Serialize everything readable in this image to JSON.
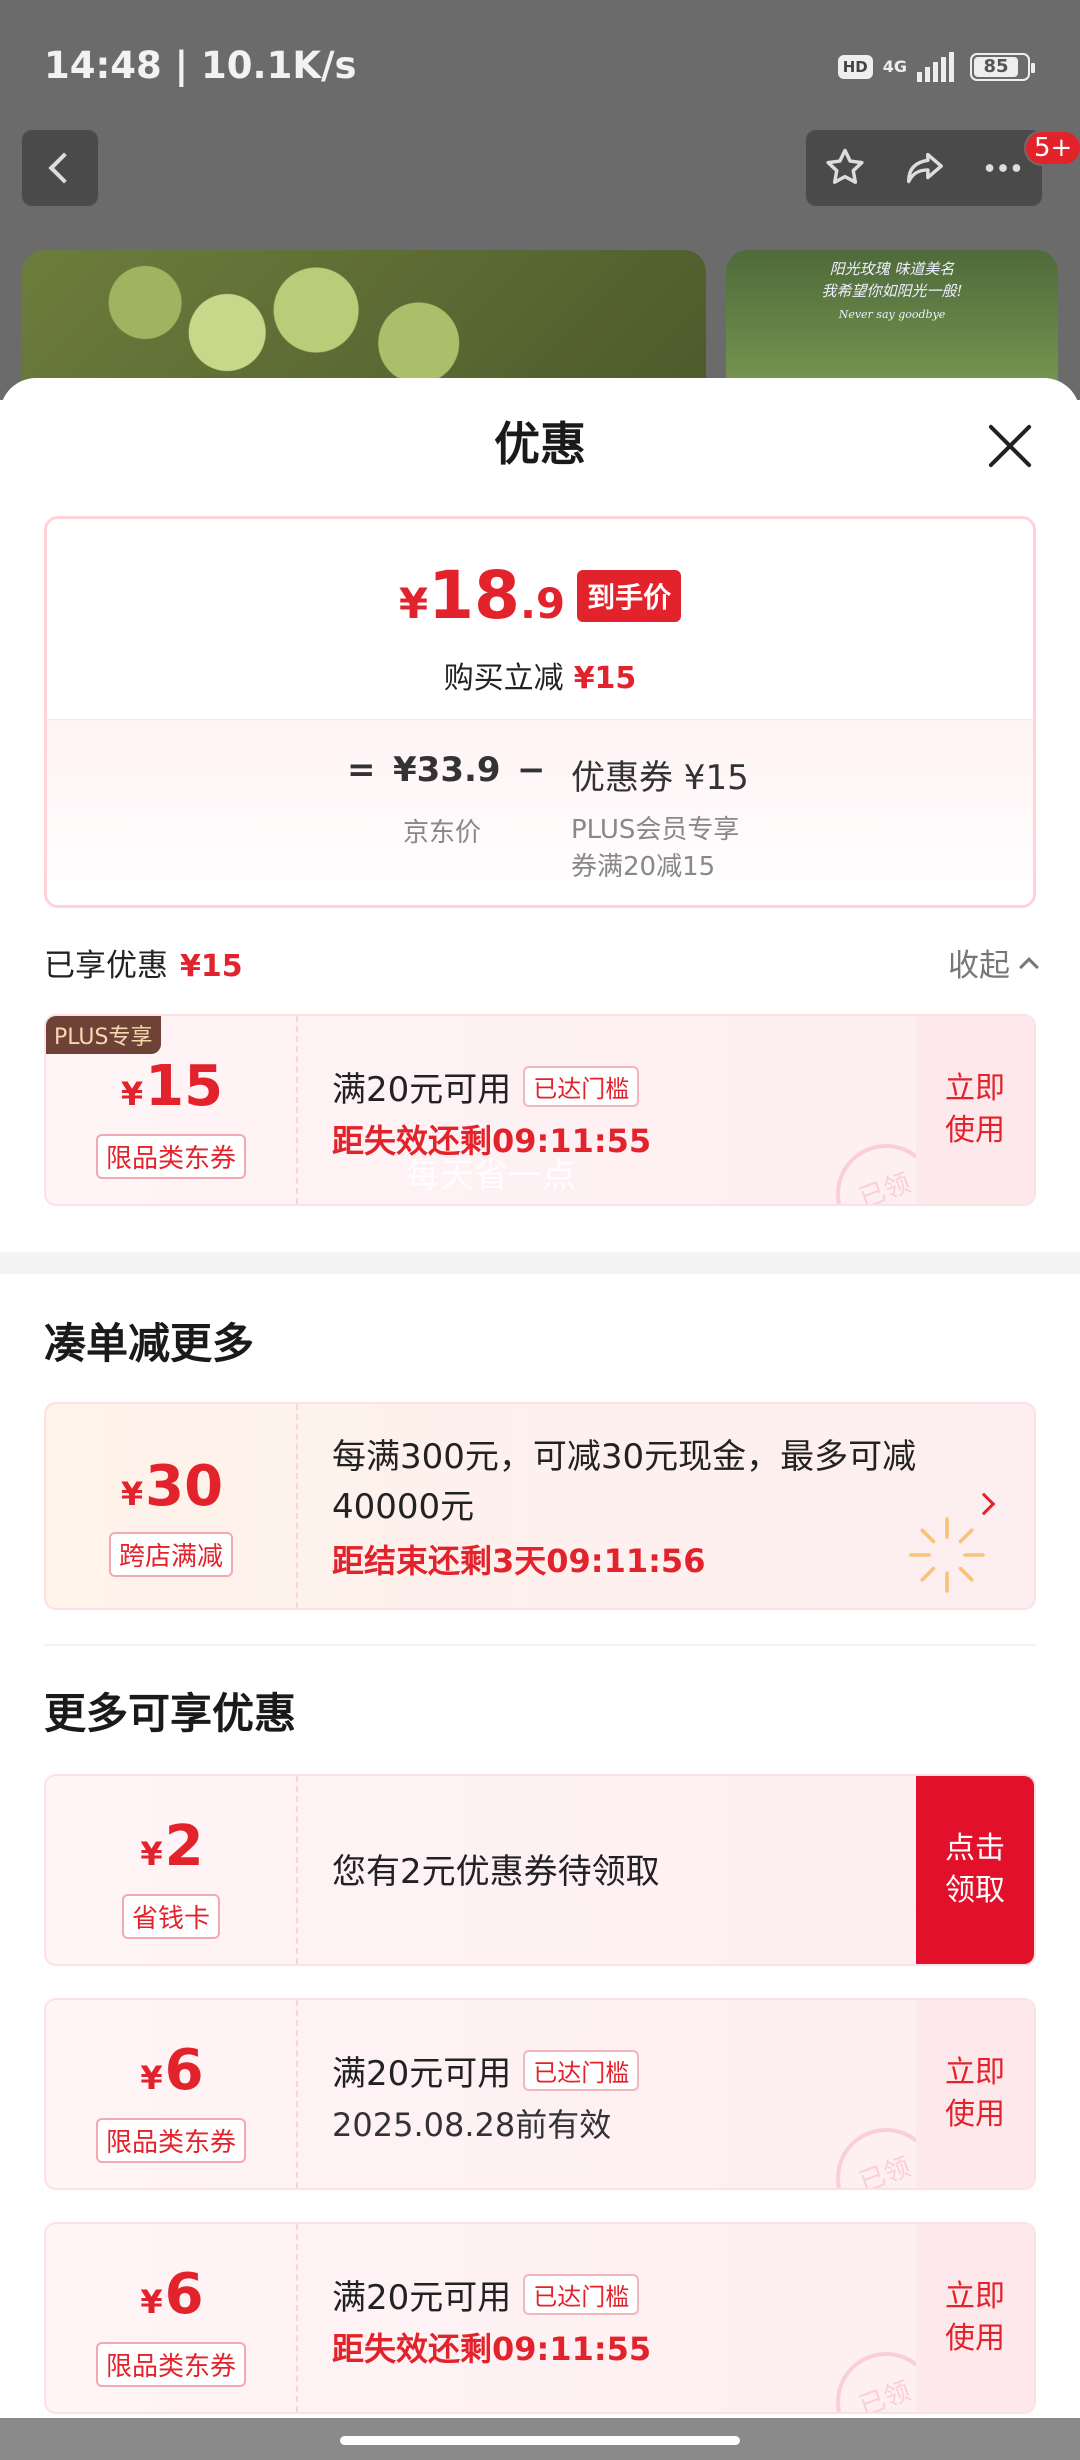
{
  "status_bar": {
    "time": "14:48 | 10.1K/s",
    "hd": "HD",
    "network": "4G",
    "battery": "85"
  },
  "top_nav": {
    "more_badge": "5+"
  },
  "photo_caption": {
    "line1": "阳光玫瑰 味道美名",
    "line2": "我希望你如阳光一般!",
    "line3": "Never say goodbye"
  },
  "sheet": {
    "title": "优惠"
  },
  "price_card": {
    "final_price_yen": "¥",
    "final_price_int": "18",
    "final_price_dec": ".9",
    "final_tag": "到手价",
    "buy_reduce_label": "购买立减",
    "buy_reduce_amount": "¥15",
    "equals": "=",
    "jd_price": "¥33.9",
    "minus": "−",
    "coupon_value": "优惠券 ¥15",
    "jd_label": "京东价",
    "plus_label_1": "PLUS会员专享",
    "plus_label_2": "券满20减15"
  },
  "enjoyed": {
    "label": "已享优惠",
    "amount": "¥15",
    "collapse": "收起"
  },
  "coupons_enjoyed": [
    {
      "plus_tag": "PLUS专享",
      "yen": "¥",
      "amount": "15",
      "type": "限品类东券",
      "title": "满20元可用",
      "threshold": "已达门槛",
      "sub": "距失效还剩09:11:55",
      "action_1": "立即",
      "action_2": "使用",
      "stamp": "已领"
    }
  ],
  "watermark": "每天省一点",
  "section_more_order": {
    "title": "凑单减更多"
  },
  "promo": {
    "yen": "¥",
    "amount": "30",
    "type": "跨店满减",
    "desc": "每满300元，可减30元现金，最多可减40000元",
    "sub": "距结束还剩3天09:11:56"
  },
  "section_more_offers": {
    "title": "更多可享优惠"
  },
  "coupons_more": [
    {
      "yen": "¥",
      "amount": "2",
      "type": "省钱卡",
      "title": "您有2元优惠券待领取",
      "action_1": "点击",
      "action_2": "领取"
    },
    {
      "yen": "¥",
      "amount": "6",
      "type": "限品类东券",
      "title": "满20元可用",
      "threshold": "已达门槛",
      "sub": "2025.08.28前有效",
      "action_1": "立即",
      "action_2": "使用",
      "stamp": "已领"
    },
    {
      "yen": "¥",
      "amount": "6",
      "type": "限品类东券",
      "title": "满20元可用",
      "threshold": "已达门槛",
      "sub": "距失效还剩09:11:55",
      "action_1": "立即",
      "action_2": "使用",
      "stamp": "已领"
    }
  ],
  "colors": {
    "accent_red": "#e3232c",
    "plus_brown": "#6e4236",
    "claim_red": "#e3102b"
  }
}
